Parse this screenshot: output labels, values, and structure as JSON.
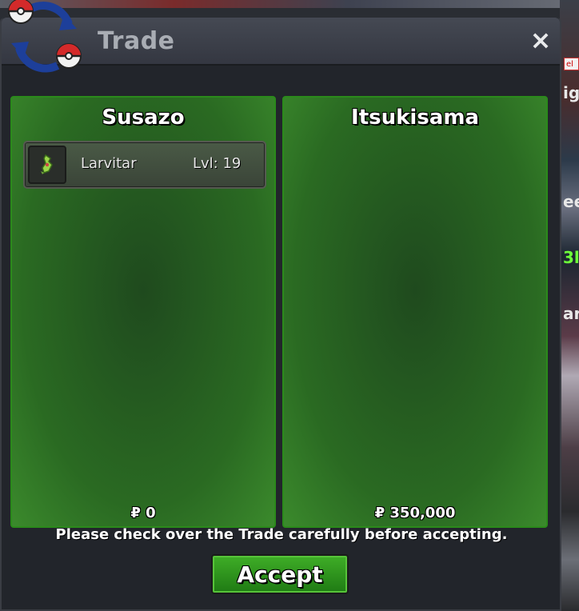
{
  "window": {
    "title": "Trade"
  },
  "icons": {
    "logo": "trade-arrows-pokeball-icon",
    "close": "close-icon",
    "pokemon": "larvitar-sprite-icon",
    "currency": "pokedollar-symbol"
  },
  "colors": {
    "panel_green": "#2a6a22",
    "panel_border": "#2b8a1b",
    "accept_green": "#2f9a1f",
    "title_gray": "#a9adb4"
  },
  "trade": {
    "left": {
      "player": "Susazo",
      "items": [
        {
          "name": "Larvitar",
          "level": "Lvl: 19"
        }
      ],
      "money": "₽ 0"
    },
    "right": {
      "player": "Itsukisama",
      "items": [],
      "money": "₽ 350,000"
    }
  },
  "footer": {
    "message": "Please check over the Trade carefully before accepting.",
    "accept_label": "Accept"
  },
  "background": {
    "fragments": [
      "el",
      "ig",
      "ee",
      "3l",
      "ar"
    ]
  }
}
